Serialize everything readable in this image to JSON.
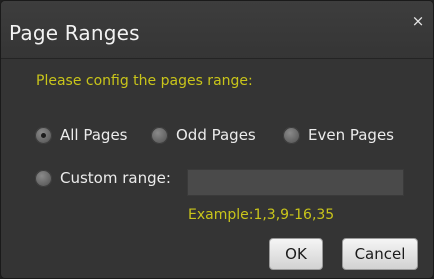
{
  "dialog": {
    "title": "Page Ranges",
    "close_glyph": "×",
    "prompt": "Please config the pages range:",
    "options": [
      {
        "label": "All Pages",
        "selected": true
      },
      {
        "label": "Odd Pages",
        "selected": false
      },
      {
        "label": "Even Pages",
        "selected": false
      },
      {
        "label": "Custom range:",
        "selected": false
      }
    ],
    "custom_range_value": "",
    "example": "Example:1,3,9-16,35",
    "ok_label": "OK",
    "cancel_label": "Cancel"
  },
  "colors": {
    "background": "#343434",
    "accent_text": "#c9c51a",
    "text": "#ececec"
  }
}
